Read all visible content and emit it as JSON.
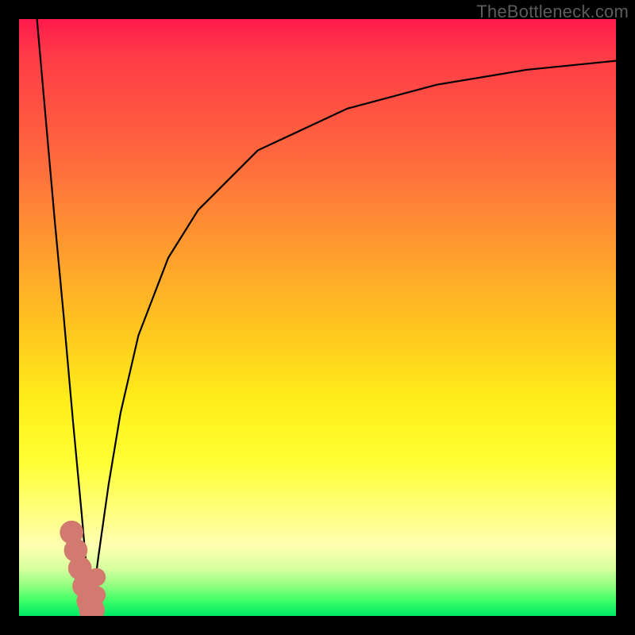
{
  "watermark": "TheBottleneck.com",
  "colors": {
    "background": "#000000",
    "curve": "#000000",
    "marker": "#d27a70",
    "gradient_top": "#ff1a4d",
    "gradient_bottom": "#00e864"
  },
  "chart_data": {
    "type": "line",
    "title": "",
    "xlabel": "",
    "ylabel": "",
    "xlim": [
      0,
      100
    ],
    "ylim": [
      0,
      100
    ],
    "grid": false,
    "note": "Two black curves forming a V/valley near x≈12; left branch steep descending line, right branch rising saturating curve. Background vertical gradient encodes value (red high, green low). Pink dotted markers along lower portion of V near the valley floor.",
    "series": [
      {
        "name": "left-branch",
        "x": [
          3.0,
          4.5,
          6.0,
          7.5,
          9.0,
          10.5,
          12.0
        ],
        "y": [
          100,
          83,
          66,
          50,
          33,
          17,
          0
        ]
      },
      {
        "name": "right-branch",
        "x": [
          12.0,
          13.3,
          15.0,
          17.0,
          20.0,
          25.0,
          30.0,
          40.0,
          55.0,
          70.0,
          85.0,
          100.0
        ],
        "y": [
          0,
          10,
          22,
          34,
          47,
          60,
          68,
          78,
          85,
          89,
          91.5,
          93
        ]
      }
    ],
    "markers": [
      {
        "x": 8.8,
        "y": 14.0,
        "r": 1.6
      },
      {
        "x": 9.5,
        "y": 11.0,
        "r": 1.6
      },
      {
        "x": 10.2,
        "y": 8.0,
        "r": 1.6
      },
      {
        "x": 10.9,
        "y": 5.0,
        "r": 1.6
      },
      {
        "x": 11.6,
        "y": 2.5,
        "r": 1.6
      },
      {
        "x": 12.2,
        "y": 1.0,
        "r": 1.8
      },
      {
        "x": 13.0,
        "y": 3.5,
        "r": 1.1
      },
      {
        "x": 13.0,
        "y": 6.5,
        "r": 1.1
      }
    ]
  }
}
